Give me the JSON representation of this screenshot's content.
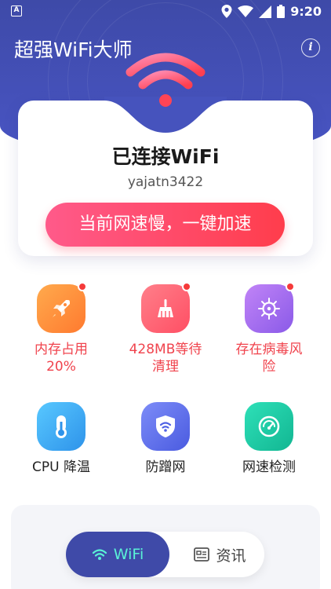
{
  "status_bar": {
    "time": "9:20",
    "app_icon": "A",
    "icons": [
      "location-icon",
      "wifi-signal-icon",
      "cell-signal-icon",
      "battery-icon"
    ]
  },
  "header": {
    "title": "超强WiFi大师",
    "info_icon": "info-icon",
    "color": "#4451b8"
  },
  "card": {
    "status": "已连接WiFi",
    "ssid": "yajatn3422",
    "boost_button": "当前网速慢，一键加速",
    "accent": "#ff4a63"
  },
  "tools": [
    {
      "icon": "rocket-icon",
      "label_lines": [
        "内存占用",
        "20%"
      ],
      "badge": true,
      "warn": true,
      "color": "#ff8a3d"
    },
    {
      "icon": "broom-icon",
      "label_lines": [
        "428MB等待",
        "清理"
      ],
      "badge": true,
      "warn": true,
      "color": "#ff5c6e"
    },
    {
      "icon": "virus-icon",
      "label_lines": [
        "存在病毒风",
        "险"
      ],
      "badge": true,
      "warn": true,
      "color": "#a56cf0"
    },
    {
      "icon": "thermometer-icon",
      "label_lines": [
        "CPU 降温"
      ],
      "badge": false,
      "warn": false,
      "color": "#2fa8ef"
    },
    {
      "icon": "shield-wifi-icon",
      "label_lines": [
        "防蹭网"
      ],
      "badge": false,
      "warn": false,
      "color": "#5367e8"
    },
    {
      "icon": "speedometer-icon",
      "label_lines": [
        "网速检测"
      ],
      "badge": false,
      "warn": false,
      "color": "#19c8a4"
    }
  ],
  "bottom_tabs": {
    "wifi": "WiFi",
    "news": "资讯",
    "active": "wifi"
  }
}
